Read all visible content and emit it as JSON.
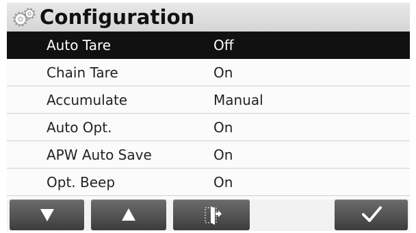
{
  "header": {
    "title": "Configuration",
    "icon": "gear-icon"
  },
  "menu": {
    "items": [
      {
        "label": "Auto Tare",
        "value": "Off",
        "selected": true
      },
      {
        "label": "Chain Tare",
        "value": "On"
      },
      {
        "label": "Accumulate",
        "value": "Manual"
      },
      {
        "label": "Auto Opt.",
        "value": "On"
      },
      {
        "label": "APW Auto Save",
        "value": "On"
      },
      {
        "label": "Opt. Beep",
        "value": "On"
      }
    ]
  },
  "softkeys": [
    {
      "icon": "arrow-down-icon"
    },
    {
      "icon": "arrow-up-icon"
    },
    {
      "icon": "exit-icon"
    },
    {
      "icon": "checkmark-icon"
    }
  ],
  "colors": {
    "selected_row": "#111111",
    "button": "#555555",
    "header": "#dcdcdc"
  }
}
